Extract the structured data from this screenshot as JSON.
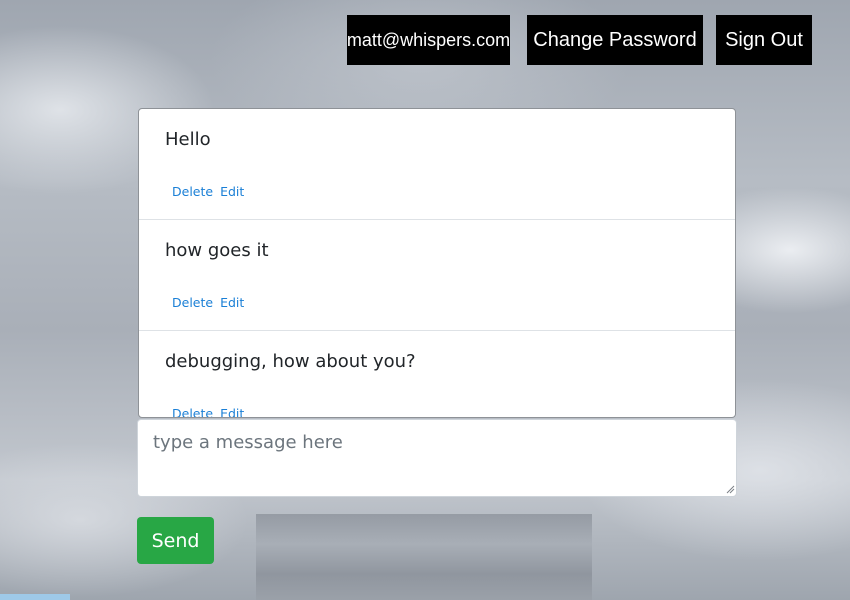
{
  "header": {
    "user_email": "matt@whispers.com",
    "change_password_label": "Change Password",
    "sign_out_label": "Sign Out"
  },
  "messages": [
    {
      "text": "Hello",
      "delete_label": "Delete",
      "edit_label": "Edit"
    },
    {
      "text": "how goes it",
      "delete_label": "Delete",
      "edit_label": "Edit"
    },
    {
      "text": "debugging, how about you?",
      "delete_label": "Delete",
      "edit_label": "Edit"
    }
  ],
  "composer": {
    "placeholder": "type a message here",
    "value": ""
  },
  "send_label": "Send",
  "colors": {
    "nav_button_bg": "#000000",
    "action_link": "#1a7fd6",
    "send_button": "#28a745"
  }
}
